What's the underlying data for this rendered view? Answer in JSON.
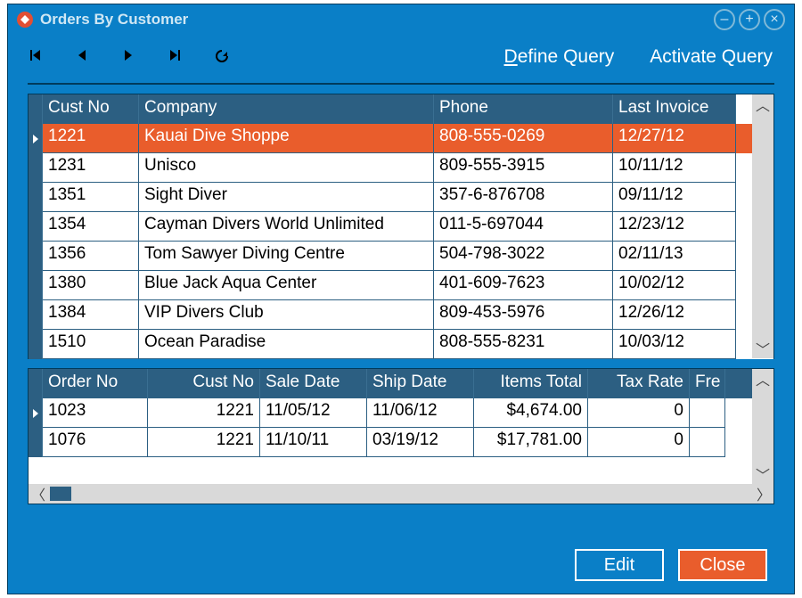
{
  "title": "Orders By Customer",
  "toolbar": {
    "define_query": "Define Query",
    "activate_query": "Activate Query"
  },
  "customers": {
    "columns": [
      "Cust No",
      "Company",
      "Phone",
      "Last Invoice"
    ],
    "rows": [
      {
        "cust": "1221",
        "company": "Kauai Dive Shoppe",
        "phone": "808-555-0269",
        "invoice": "12/27/12",
        "selected": true
      },
      {
        "cust": "1231",
        "company": "Unisco",
        "phone": "809-555-3915",
        "invoice": "10/11/12"
      },
      {
        "cust": "1351",
        "company": "Sight Diver",
        "phone": "357-6-876708",
        "invoice": "09/11/12"
      },
      {
        "cust": "1354",
        "company": "Cayman Divers World Unlimited",
        "phone": "011-5-697044",
        "invoice": "12/23/12"
      },
      {
        "cust": "1356",
        "company": "Tom Sawyer Diving Centre",
        "phone": "504-798-3022",
        "invoice": "02/11/13"
      },
      {
        "cust": "1380",
        "company": "Blue Jack Aqua Center",
        "phone": "401-609-7623",
        "invoice": "10/02/12"
      },
      {
        "cust": "1384",
        "company": "VIP Divers Club",
        "phone": "809-453-5976",
        "invoice": "12/26/12"
      },
      {
        "cust": "1510",
        "company": "Ocean Paradise",
        "phone": "808-555-8231",
        "invoice": "10/03/12"
      }
    ]
  },
  "orders": {
    "columns": [
      "Order No",
      "Cust No",
      "Sale Date",
      "Ship Date",
      "Items Total",
      "Tax Rate",
      "Fre"
    ],
    "rows": [
      {
        "order": "1023",
        "cust": "1221",
        "sale": "11/05/12",
        "ship": "11/06/12",
        "items": "$4,674.00",
        "tax": "0",
        "selected": true
      },
      {
        "order": "1076",
        "cust": "1221",
        "sale": "11/10/11",
        "ship": "03/19/12",
        "items": "$17,781.00",
        "tax": "0"
      }
    ]
  },
  "buttons": {
    "edit": "Edit",
    "close": "Close"
  }
}
